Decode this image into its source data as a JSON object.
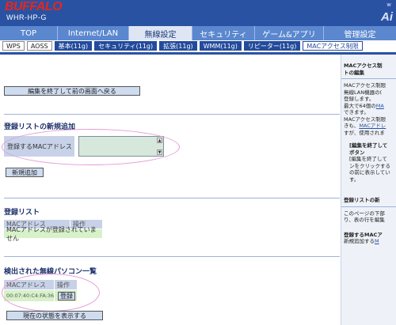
{
  "header": {
    "logo": "BUFFALO",
    "model": "WHR-HP-G",
    "brand_right": "Ai",
    "brand_right_small": "w"
  },
  "tabs": [
    {
      "label": "TOP"
    },
    {
      "label": "Internet/LAN"
    },
    {
      "label": "無線設定"
    },
    {
      "label": "セキュリティ"
    },
    {
      "label": "ゲーム&アプリ"
    },
    {
      "label": "管理設定"
    }
  ],
  "subnav": [
    {
      "label": "WPS"
    },
    {
      "label": "AOSS"
    },
    {
      "label": "基本(11g)"
    },
    {
      "label": "セキュリティ(11g)"
    },
    {
      "label": "拡張(11g)"
    },
    {
      "label": "WMM(11g)"
    },
    {
      "label": "リピーター(11g)"
    },
    {
      "label": "MACアクセス制限"
    }
  ],
  "main": {
    "back_button": "編集を終了して前の画面へ戻る",
    "add_section_title": "登録リストの新規追加",
    "mac_label": "登録するMACアドレス",
    "mac_value": "",
    "add_button": "新規追加",
    "list_title": "登録リスト",
    "list_col_mac": "MACアドレス",
    "list_col_op": "操作",
    "list_empty": "MACアドレスが登録されていません",
    "detected_title": "検出された無線パソコン一覧",
    "detected_col_mac": "MACアドレス",
    "detected_col_op": "操作",
    "detected_mac": "00:07:40:C4:FA:36",
    "register_button": "登録",
    "refresh_button": "現在の状態を表示する"
  },
  "side": {
    "l1": "MACアクセス制",
    "l2": "トの編集",
    "l3": "MACアクセス制限",
    "l4": "無線LAN機器の(",
    "l5": "登録します。",
    "l6a": "最大で64個の",
    "l6b": "MA",
    "l7": "できます。",
    "l8": "MACアクセス制限",
    "l9a": "きも、",
    "l9b": "MACアドレ",
    "l10": "すが、使用されま",
    "l11": "[編集を終了して",
    "l12": "ボタン",
    "l13": "[編集を終了して",
    "l14": "ンをクリックする",
    "l15": "の前に表示してい",
    "l16": "す。",
    "l17": "登録リストの新",
    "l18": "このページの下部",
    "l19": "り、表の行を編集",
    "l20": "登録するMACア",
    "l21a": "新規追加する",
    "l21b": "M"
  },
  "colors": {
    "header_bg": "#2a52a3",
    "tab_bg": "#5b87cf",
    "logo": "#e8251c",
    "highlight_ellipse": "#e79ad6"
  }
}
